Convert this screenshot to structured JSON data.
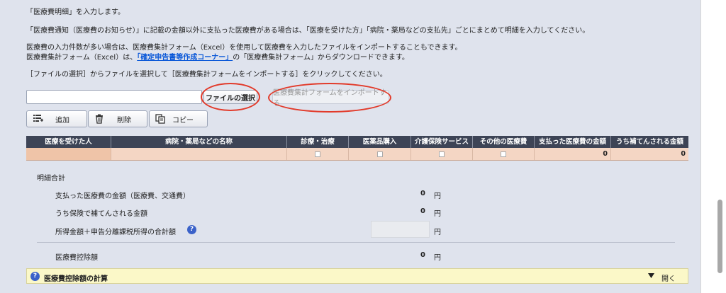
{
  "intro": {
    "line1": "「医療費明細」を入力します。",
    "line2": "「医療費通知（医療費のお知らせ）」に記載の金額以外に支払った医療費がある場合は、「医療を受けた方」「病院・薬局などの支払先」ごとにまとめて明細を入力してください。",
    "line3": "医療費の入力件数が多い場合は、医療費集計フォーム（Excel）を使用して医療費を入力したファイルをインポートすることもできます。",
    "line4_prefix": "医療費集計フォーム（Excel）は、",
    "line4_link": "「確定申告書等作成コーナー」",
    "line4_suffix": "の「医療費集計フォーム」からダウンロードできます。",
    "line5": "［ファイルの選択］からファイルを選択して［医療費集計フォームをインポートする］をクリックしてください。"
  },
  "file": {
    "value": "",
    "select_label": "ファイルの選択",
    "import_label": "医療費集計フォームをインポートする"
  },
  "toolbar": {
    "add_label": "追加",
    "delete_label": "削除",
    "copy_label": "コピー"
  },
  "table": {
    "headers": [
      "医療を受けた人",
      "病院・薬局などの名称",
      "診療・治療",
      "医薬品購入",
      "介護保険サービス",
      "その他の医療費",
      "支払った医療費の金額",
      "うち補てんされる金額"
    ],
    "row": {
      "paid": "0",
      "covered": "0"
    }
  },
  "summary": {
    "title": "明細合計",
    "paid_label": "支払った医療費の金額（医療費、交通費）",
    "paid_value": "0",
    "covered_label": "うち保険で補てんされる金額",
    "covered_value": "0",
    "income_label": "所得金額＋申告分離課税所得の合計額",
    "income_value": "",
    "deduction_label": "医療費控除額",
    "deduction_value": "0",
    "yen": "円"
  },
  "calc": {
    "label": "医療費控除額の計算",
    "toggle": "開く"
  },
  "colors": {
    "panel_bg": "#dfe3ed",
    "header_bg": "#3d4456",
    "row_bg": "#f4d6c4",
    "highlight": "#e23a2a",
    "link": "#0a58d8",
    "calc_bg": "#fbf8c8",
    "help_bg": "#3b62c9"
  }
}
